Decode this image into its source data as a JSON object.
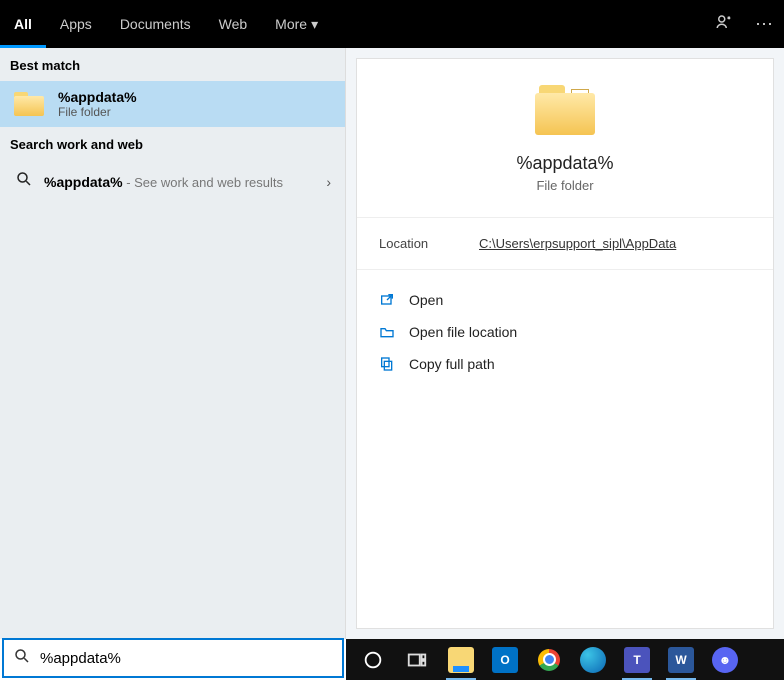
{
  "tabs": {
    "items": [
      "All",
      "Apps",
      "Documents",
      "Web",
      "More"
    ],
    "active": 0
  },
  "sections": {
    "best_match": "Best match",
    "work_web": "Search work and web"
  },
  "best": {
    "title": "%appdata%",
    "subtitle": "File folder"
  },
  "web": {
    "query": "%appdata%",
    "suffix": " - See work and web results"
  },
  "preview": {
    "title": "%appdata%",
    "subtitle": "File folder",
    "location_label": "Location",
    "location_value": "C:\\Users\\erpsupport_sipl\\AppData"
  },
  "actions": {
    "open": "Open",
    "open_loc": "Open file location",
    "copy_path": "Copy full path"
  },
  "search": {
    "value": "%appdata%"
  }
}
